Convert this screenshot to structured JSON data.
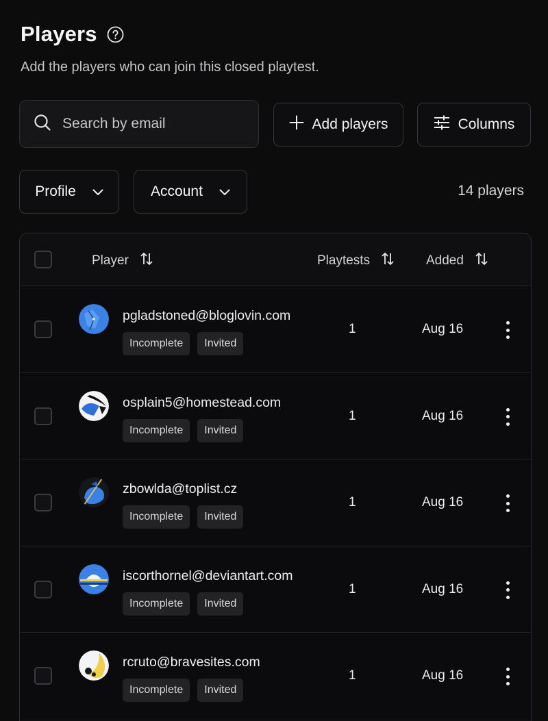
{
  "header": {
    "title": "Players",
    "subtitle": "Add the players who can join this closed playtest."
  },
  "toolbar": {
    "search_placeholder": "Search by email",
    "add_players_label": "Add players",
    "columns_label": "Columns"
  },
  "filters": {
    "profile_label": "Profile",
    "account_label": "Account",
    "count_text": "14 players"
  },
  "table": {
    "headers": {
      "player": "Player",
      "playtests": "Playtests",
      "added": "Added"
    },
    "rows": [
      {
        "email": "pgladstoned@bloglovin.com",
        "status": "Incomplete",
        "invite": "Invited",
        "playtests": "1",
        "added": "Aug 16"
      },
      {
        "email": "osplain5@homestead.com",
        "status": "Incomplete",
        "invite": "Invited",
        "playtests": "1",
        "added": "Aug 16"
      },
      {
        "email": "zbowlda@toplist.cz",
        "status": "Incomplete",
        "invite": "Invited",
        "playtests": "1",
        "added": "Aug 16"
      },
      {
        "email": "iscorthornel@deviantart.com",
        "status": "Incomplete",
        "invite": "Invited",
        "playtests": "1",
        "added": "Aug 16"
      },
      {
        "email": "rcruto@bravesites.com",
        "status": "Incomplete",
        "invite": "Invited",
        "playtests": "1",
        "added": "Aug 16"
      }
    ]
  },
  "colors": {
    "background": "#0c0c0d",
    "avatar_blue": "#3b82e6",
    "avatar_yellow": "#f2cf4a"
  },
  "icons": {
    "help": "question-circle-icon",
    "search": "search-icon",
    "add": "plus-icon",
    "columns": "sliders-icon",
    "dropdown": "chevron-down-icon",
    "sort": "sort-arrows-icon",
    "more": "more-vertical-icon"
  }
}
